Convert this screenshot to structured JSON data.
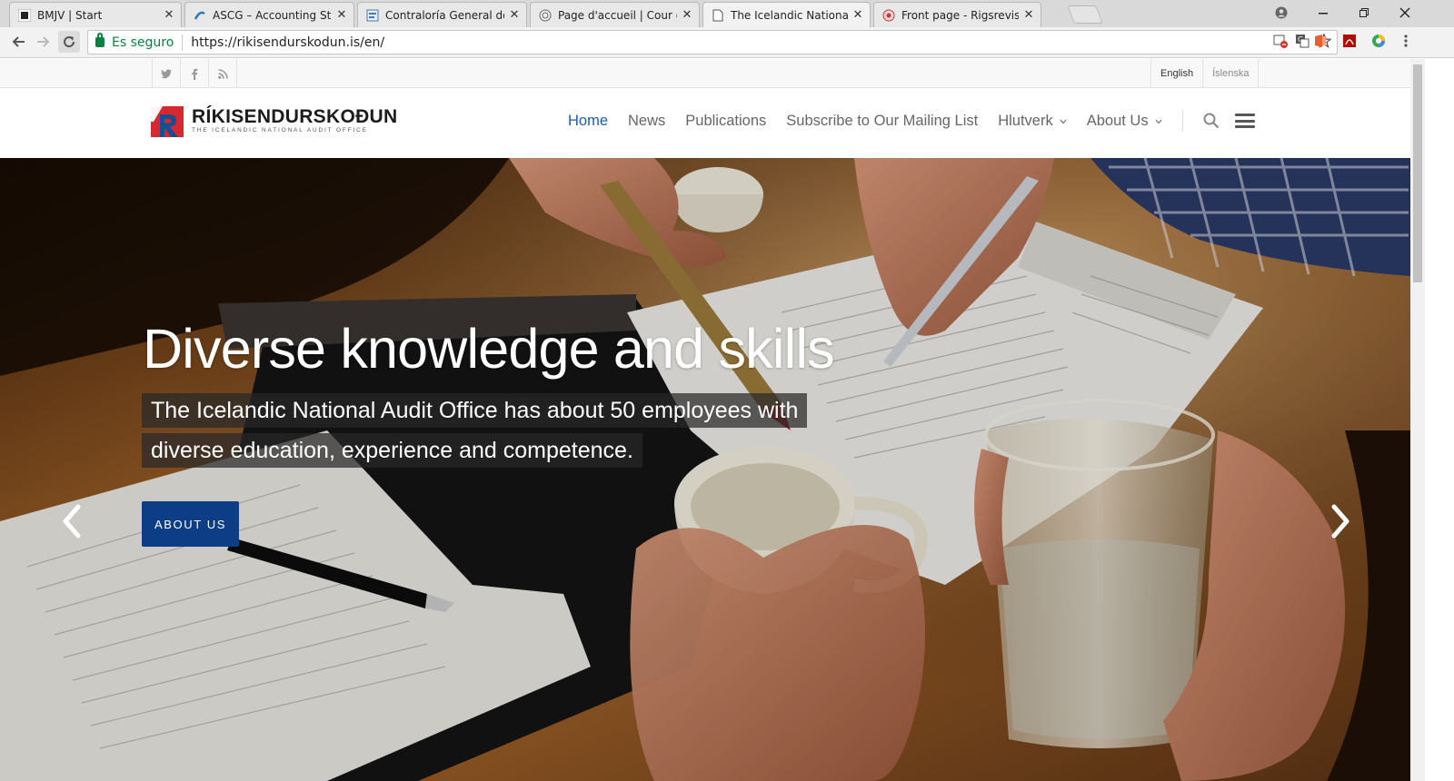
{
  "browser": {
    "tabs": [
      {
        "title": "BMJV | Start",
        "active": false
      },
      {
        "title": "ASCG – Accounting Standards",
        "active": false
      },
      {
        "title": "Contraloría General de la",
        "active": false
      },
      {
        "title": "Page d'accueil | Cour des",
        "active": false
      },
      {
        "title": "The Icelandic National Audit",
        "active": true
      },
      {
        "title": "Front page - Rigsrevisionen",
        "active": false
      }
    ],
    "secure_label": "Es seguro",
    "url": "https://rikisendurskodun.is/en/"
  },
  "site": {
    "languages": [
      "English",
      "Íslenska"
    ],
    "logo": {
      "name": "RÍKISENDURSKOÐUN",
      "tagline": "THE ICELANDIC NATIONAL AUDIT OFFICE",
      "brand_red": "#d7282f",
      "brand_blue": "#1a4e8f"
    },
    "nav": [
      {
        "label": "Home",
        "active": true
      },
      {
        "label": "News"
      },
      {
        "label": "Publications"
      },
      {
        "label": "Subscribe to Our Mailing List"
      },
      {
        "label": "Hlutverk",
        "dropdown": true
      },
      {
        "label": "About Us",
        "dropdown": true
      }
    ],
    "icons": {
      "search": "search-icon",
      "menu": "hamburger-menu-icon",
      "social": [
        "twitter-icon",
        "facebook-icon",
        "rss-icon"
      ]
    }
  },
  "hero": {
    "title": "Diverse knowledge and skills",
    "text_line1": "The Icelandic National Audit Office has about 50 employees with",
    "text_line2": "diverse education, experience and competence.",
    "button": "ABOUT US",
    "button_color": "#0d3d85"
  }
}
